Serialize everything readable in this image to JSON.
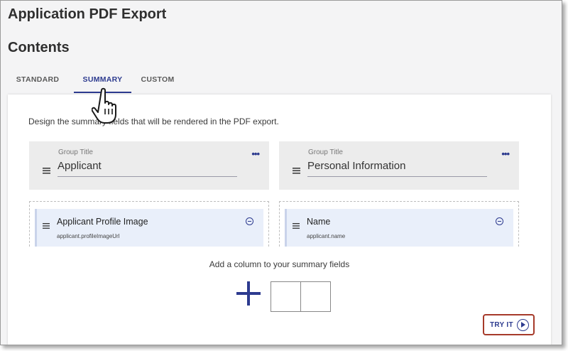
{
  "app": {
    "title": "Application PDF Export"
  },
  "section": {
    "title": "Contents"
  },
  "tabs": [
    {
      "label": "STANDARD",
      "active": false
    },
    {
      "label": "SUMMARY",
      "active": true
    },
    {
      "label": "CUSTOM",
      "active": false
    }
  ],
  "summary": {
    "description": "Design the summary fields that will be rendered in the PDF export.",
    "groups": [
      {
        "group_title_label": "Group Title",
        "group_title_value": "Applicant",
        "fields": [
          {
            "name": "Applicant Profile Image",
            "path": "applicant.profileImageUrl"
          }
        ]
      },
      {
        "group_title_label": "Group Title",
        "group_title_value": "Personal Information",
        "fields": [
          {
            "name": "Name",
            "path": "applicant.name"
          }
        ]
      }
    ],
    "add_column_text": "Add a column to your summary fields"
  },
  "try_it": {
    "label": "TRY IT"
  },
  "colors": {
    "accent": "#2d3b8f",
    "highlight_border": "#a63a2a",
    "field_bg": "#e9effa"
  }
}
